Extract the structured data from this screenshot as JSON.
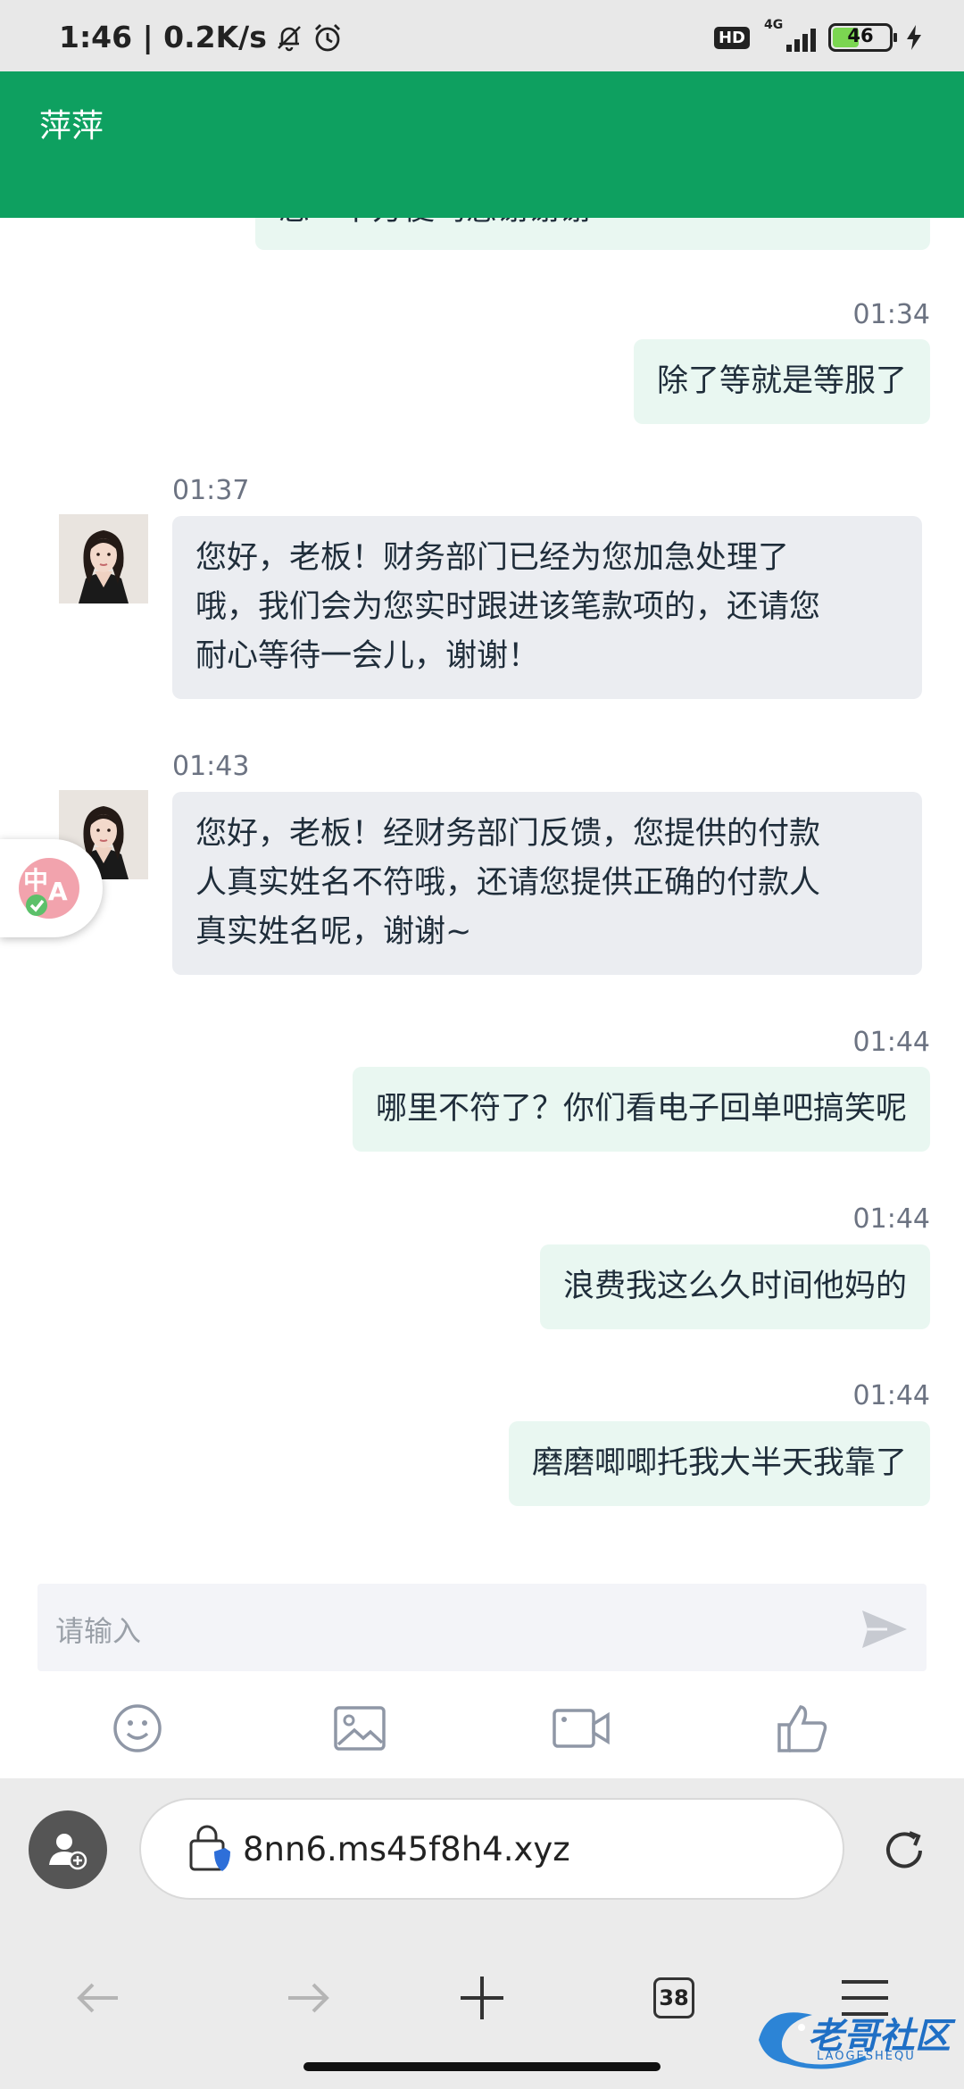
{
  "status_bar": {
    "time_and_speed": "1:46 | 0.2K/s",
    "hd_label": "HD",
    "network_label": "4G",
    "battery_level": "46"
  },
  "header": {
    "title": "萍萍"
  },
  "messages": [
    {
      "direction": "out",
      "time": "",
      "text": "您一下方便吗感谢谢谢"
    },
    {
      "direction": "out",
      "time": "01:34",
      "text": "除了等就是等服了"
    },
    {
      "direction": "in",
      "time": "01:37",
      "lines": [
        "您好，老板！财务部门已经为您加急处理了",
        "哦，我们会为您实时跟进该笔款项的，还请您",
        "耐心等待一会儿，谢谢！"
      ]
    },
    {
      "direction": "in",
      "time": "01:43",
      "lines": [
        "您好，老板！经财务部门反馈，您提供的付款",
        "人真实姓名不符哦，还请您提供正确的付款人",
        "真实姓名呢，谢谢~"
      ]
    },
    {
      "direction": "out",
      "time": "01:44",
      "text": "哪里不符了？你们看电子回单吧搞笑呢"
    },
    {
      "direction": "out",
      "time": "01:44",
      "text": "浪费我这么久时间他妈的"
    },
    {
      "direction": "out",
      "time": "01:44",
      "text": "磨磨唧唧托我大半天我靠了"
    }
  ],
  "input": {
    "placeholder": "请输入"
  },
  "toolbar": {
    "icons": [
      "emoji-icon",
      "image-icon",
      "video-icon",
      "thumbs-up-icon"
    ]
  },
  "browser": {
    "url": "8nn6.ms45f8h4.xyz",
    "tab_count": "38"
  },
  "watermark": {
    "text": "老哥社区",
    "subtext": "LAOGESHEQU"
  },
  "colors": {
    "header_green": "#0ea060",
    "outgoing_bubble": "#e9f7f1",
    "incoming_bubble": "#ebedf1"
  }
}
